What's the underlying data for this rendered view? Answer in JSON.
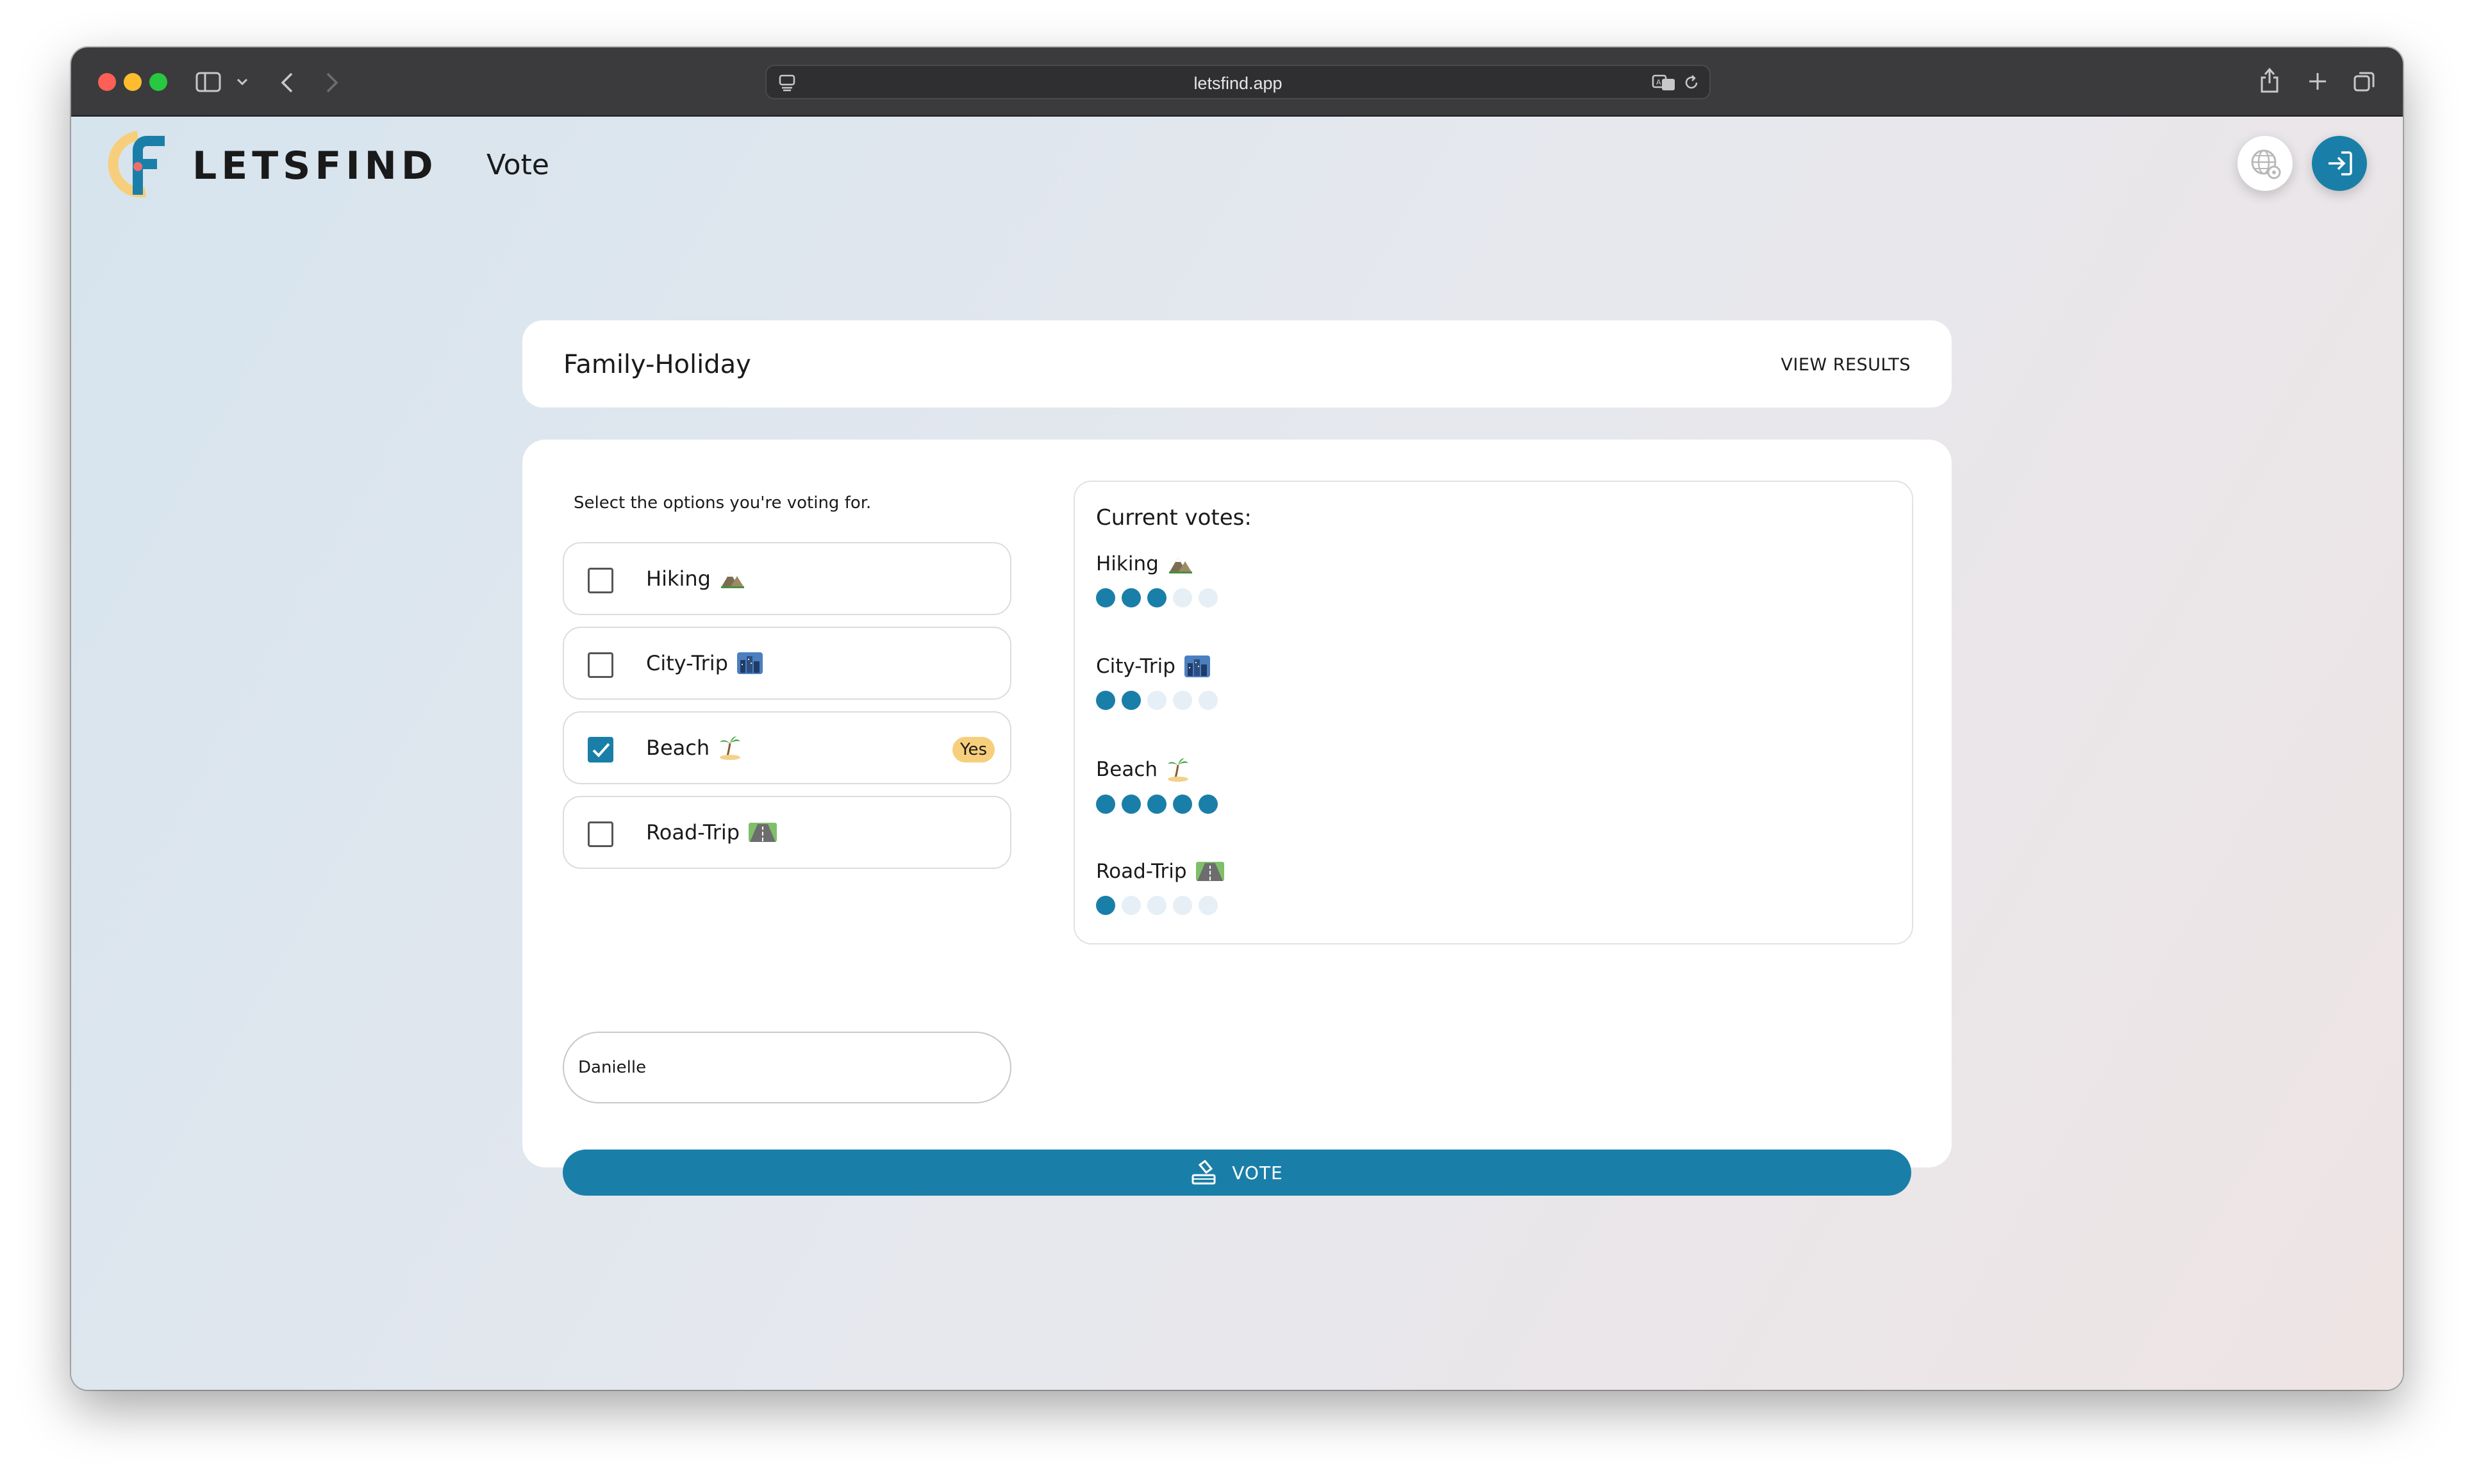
{
  "browser": {
    "url": "letsfind.app"
  },
  "app": {
    "logo_text": "LETSFIND",
    "page_heading": "Vote",
    "accent_color": "#1a7fa8"
  },
  "poll": {
    "name": "Family-Holiday",
    "view_results_label": "VIEW RESULTS"
  },
  "ballot": {
    "instruction": "Select the options you're voting for.",
    "options": [
      {
        "label": "Hiking",
        "icon": "mountain-icon",
        "checked": false
      },
      {
        "label": "City-Trip",
        "icon": "cityscape-icon",
        "checked": false
      },
      {
        "label": "Beach",
        "icon": "palm-island-icon",
        "checked": true,
        "badge": "Yes"
      },
      {
        "label": "Road-Trip",
        "icon": "road-icon",
        "checked": false
      }
    ],
    "name_value": "Danielle",
    "vote_button_label": "VOTE"
  },
  "current_votes": {
    "title": "Current votes:",
    "max_dots": 5,
    "rows": [
      {
        "label": "Hiking",
        "icon": "mountain-icon",
        "votes": 3
      },
      {
        "label": "City-Trip",
        "icon": "cityscape-icon",
        "votes": 2
      },
      {
        "label": "Beach",
        "icon": "palm-island-icon",
        "votes": 5
      },
      {
        "label": "Road-Trip",
        "icon": "road-icon",
        "votes": 1
      }
    ]
  }
}
